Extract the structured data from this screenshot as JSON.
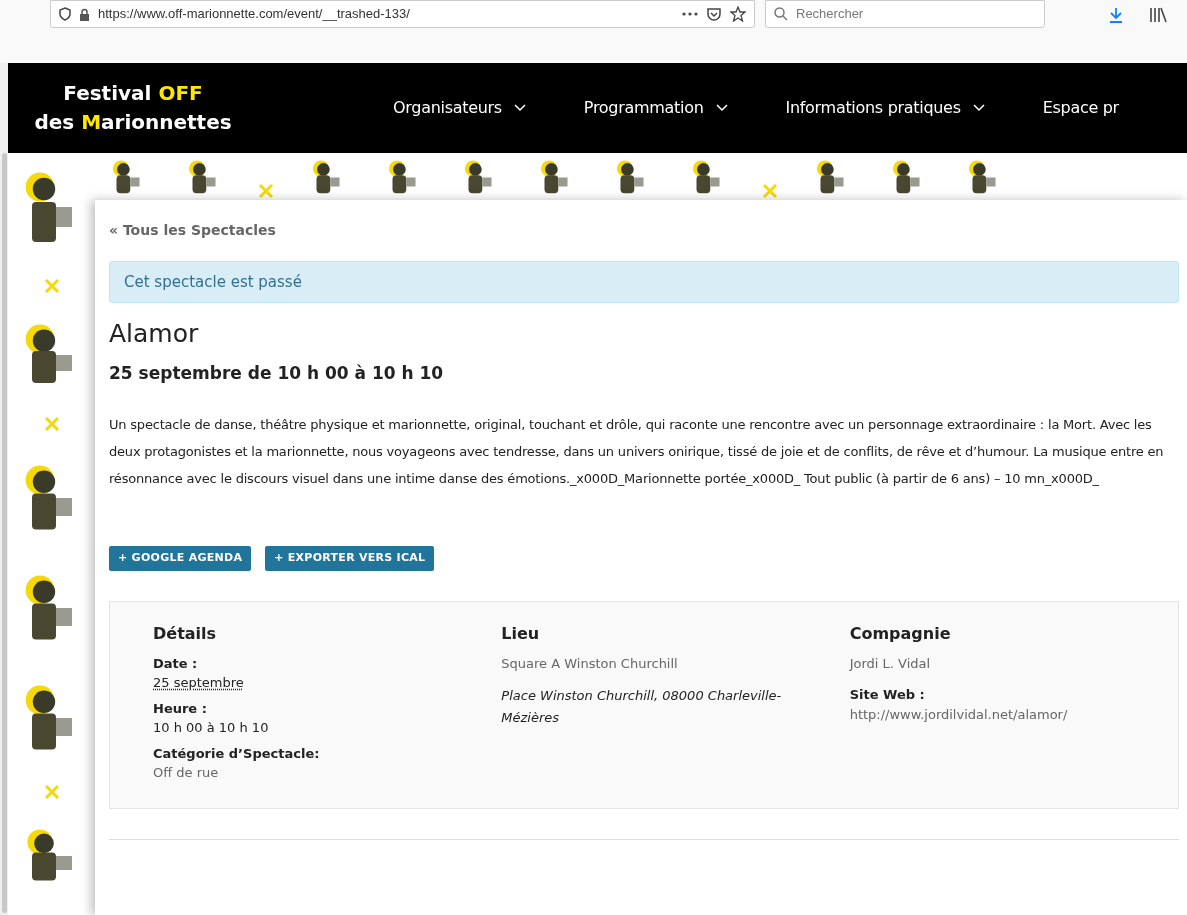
{
  "browser": {
    "url": "https://www.off-marionnette.com/event/__trashed-133/",
    "search_placeholder": "Rechercher"
  },
  "logo": {
    "line1": [
      {
        "text": "Festival ",
        "highlight": false
      },
      {
        "text": "OFF",
        "highlight": true
      }
    ],
    "line2": [
      {
        "text": "des ",
        "highlight": false
      },
      {
        "text": "M",
        "highlight": true
      },
      {
        "text": "arionnettes",
        "highlight": false
      }
    ]
  },
  "nav": [
    "Organisateurs",
    "Programmation",
    "Informations pratiques",
    "Espace pr"
  ],
  "back_link": "« Tous les Spectacles",
  "notice": "Cet spectacle est passé",
  "event": {
    "title": "Alamor",
    "date": "25 septembre de 10 h 00 à 10 h 10",
    "description": "Un spectacle de danse, théâtre physique et marionnette, original, touchant et drôle, qui raconte une rencontre avec un personnage extraordinaire : la Mort. Avec les deux protagonistes et la marionnette, nous voyageons avec tendresse, dans un univers onirique, tissé de joie et de conflits, de rêve et d’humour. La musique entre en résonnance avec le discours visuel dans une intime danse des émotions._x000D_Marionnette portée_x000D_ Tout public (à partir de 6 ans) – 10 mn_x000D_"
  },
  "buttons": [
    "+ GOOGLE AGENDA",
    "+ EXPORTER VERS ICAL"
  ],
  "details": [
    {
      "heading": "Détails",
      "items": [
        {
          "kind": "date",
          "label": "Date :",
          "value": "25 septembre"
        },
        {
          "kind": "time",
          "label": "Heure :",
          "value": "10 h 00 à 10 h 10"
        },
        {
          "kind": "category",
          "label": "Catégorie d’Spectacle:",
          "value": "Off de rue"
        }
      ]
    },
    {
      "heading": "Lieu",
      "items": [
        {
          "kind": "name",
          "value": "Square A Winston Churchill"
        },
        {
          "kind": "address",
          "value": "Place Winston Churchill, 08000 Charleville-Mézières"
        }
      ]
    },
    {
      "heading": "Compagnie",
      "items": [
        {
          "kind": "name",
          "value": "Jordi L. Vidal"
        },
        {
          "kind": "website",
          "label": "Site Web :",
          "value": "http://www.jordilvidal.net/alamor/"
        }
      ]
    }
  ]
}
